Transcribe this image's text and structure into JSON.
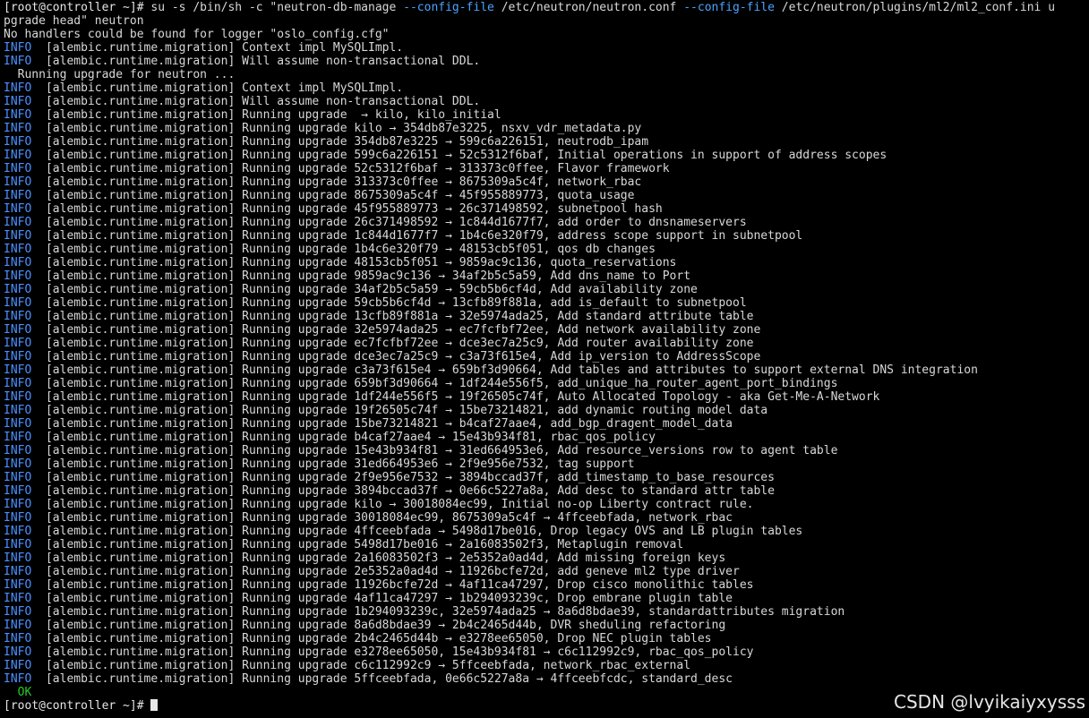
{
  "colors": {
    "background": "#000000",
    "text": "#d8d8d8",
    "info_level": "#4a90ff",
    "flag": "#4aa3ff",
    "ok": "#28c828"
  },
  "command": {
    "prompt": "[root@controller ~]# ",
    "cmd_a": "su -s /bin/sh -c \"neutron-db-manage ",
    "flag_a": "--config-file",
    "cmd_b": " /etc/neutron/neutron.conf ",
    "flag_b": "--config-file",
    "cmd_c": " /etc/neutron/plugins/ml2/ml2_conf.ini u",
    "wrap": "pgrade head\" neutron"
  },
  "notice": "No handlers could be found for logger \"oslo_config.cfg\"",
  "level": "INFO",
  "logger": "  [alembic.runtime.migration] ",
  "pre_logs": [
    "Context impl MySQLImpl.",
    "Will assume non-transactional DDL."
  ],
  "running_msg": "  Running upgrade for neutron ...",
  "logs": [
    "Context impl MySQLImpl.",
    "Will assume non-transactional DDL.",
    "Running upgrade  → kilo, kilo_initial",
    "Running upgrade kilo → 354db87e3225, nsxv_vdr_metadata.py",
    "Running upgrade 354db87e3225 → 599c6a226151, neutrodb_ipam",
    "Running upgrade 599c6a226151 → 52c5312f6baf, Initial operations in support of address scopes",
    "Running upgrade 52c5312f6baf → 313373c0ffee, Flavor framework",
    "Running upgrade 313373c0ffee → 8675309a5c4f, network_rbac",
    "Running upgrade 8675309a5c4f → 45f955889773, quota_usage",
    "Running upgrade 45f955889773 → 26c371498592, subnetpool hash",
    "Running upgrade 26c371498592 → 1c844d1677f7, add order to dnsnameservers",
    "Running upgrade 1c844d1677f7 → 1b4c6e320f79, address scope support in subnetpool",
    "Running upgrade 1b4c6e320f79 → 48153cb5f051, qos db changes",
    "Running upgrade 48153cb5f051 → 9859ac9c136, quota_reservations",
    "Running upgrade 9859ac9c136 → 34af2b5c5a59, Add dns_name to Port",
    "Running upgrade 34af2b5c5a59 → 59cb5b6cf4d, Add availability zone",
    "Running upgrade 59cb5b6cf4d → 13cfb89f881a, add is_default to subnetpool",
    "Running upgrade 13cfb89f881a → 32e5974ada25, Add standard attribute table",
    "Running upgrade 32e5974ada25 → ec7fcfbf72ee, Add network availability zone",
    "Running upgrade ec7fcfbf72ee → dce3ec7a25c9, Add router availability zone",
    "Running upgrade dce3ec7a25c9 → c3a73f615e4, Add ip_version to AddressScope",
    "Running upgrade c3a73f615e4 → 659bf3d90664, Add tables and attributes to support external DNS integration",
    "Running upgrade 659bf3d90664 → 1df244e556f5, add_unique_ha_router_agent_port_bindings",
    "Running upgrade 1df244e556f5 → 19f26505c74f, Auto Allocated Topology - aka Get-Me-A-Network",
    "Running upgrade 19f26505c74f → 15be73214821, add dynamic routing model data",
    "Running upgrade 15be73214821 → b4caf27aae4, add_bgp_dragent_model_data",
    "Running upgrade b4caf27aae4 → 15e43b934f81, rbac_qos_policy",
    "Running upgrade 15e43b934f81 → 31ed664953e6, Add resource_versions row to agent table",
    "Running upgrade 31ed664953e6 → 2f9e956e7532, tag support",
    "Running upgrade 2f9e956e7532 → 3894bccad37f, add_timestamp_to_base_resources",
    "Running upgrade 3894bccad37f → 0e66c5227a8a, Add desc to standard attr table",
    "Running upgrade kilo → 30018084ec99, Initial no-op Liberty contract rule.",
    "Running upgrade 30018084ec99, 8675309a5c4f → 4ffceebfada, network_rbac",
    "Running upgrade 4ffceebfada → 5498d17be016, Drop legacy OVS and LB plugin tables",
    "Running upgrade 5498d17be016 → 2a16083502f3, Metaplugin removal",
    "Running upgrade 2a16083502f3 → 2e5352a0ad4d, Add missing foreign keys",
    "Running upgrade 2e5352a0ad4d → 11926bcfe72d, add geneve ml2 type driver",
    "Running upgrade 11926bcfe72d → 4af11ca47297, Drop cisco monolithic tables",
    "Running upgrade 4af11ca47297 → 1b294093239c, Drop embrane plugin table",
    "Running upgrade 1b294093239c, 32e5974ada25 → 8a6d8bdae39, standardattributes migration",
    "Running upgrade 8a6d8bdae39 → 2b4c2465d44b, DVR sheduling refactoring",
    "Running upgrade 2b4c2465d44b → e3278ee65050, Drop NEC plugin tables",
    "Running upgrade e3278ee65050, 15e43b934f81 → c6c112992c9, rbac_qos_policy",
    "Running upgrade c6c112992c9 → 5ffceebfada, network_rbac_external",
    "Running upgrade 5ffceebfada, 0e66c5227a8a → 4ffceebfcdc, standard_desc"
  ],
  "ok": "  OK",
  "final_prompt": "[root@controller ~]# ",
  "watermark": "CSDN @lvyikaiyxysss"
}
